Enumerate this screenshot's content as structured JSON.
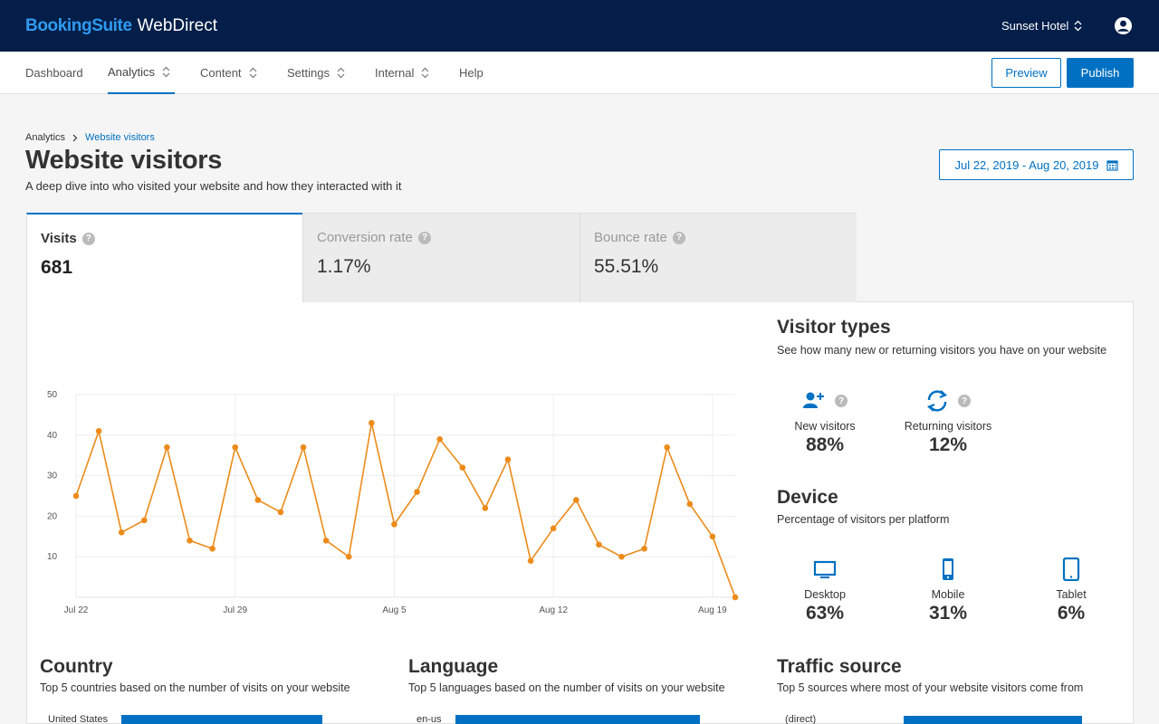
{
  "brand": {
    "part1": "BookingSuite",
    "part2": "WebDirect"
  },
  "hotel": {
    "name": "Sunset Hotel"
  },
  "nav": {
    "items": [
      {
        "label": "Dashboard"
      },
      {
        "label": "Analytics"
      },
      {
        "label": "Content"
      },
      {
        "label": "Settings"
      },
      {
        "label": "Internal"
      },
      {
        "label": "Help"
      }
    ],
    "active": "Analytics",
    "preview_label": "Preview",
    "publish_label": "Publish"
  },
  "breadcrumb": {
    "parent": "Analytics",
    "current": "Website visitors"
  },
  "page": {
    "title": "Website visitors",
    "subtitle": "A deep dive into who visited your website and how they interacted with it",
    "date_range": "Jul 22, 2019 - Aug 20, 2019"
  },
  "metrics": [
    {
      "label": "Visits",
      "value": "681"
    },
    {
      "label": "Conversion rate",
      "value": "1.17%"
    },
    {
      "label": "Bounce rate",
      "value": "55.51%"
    }
  ],
  "chart_data": {
    "type": "line",
    "x": [
      "Jul 22",
      "Jul 23",
      "Jul 24",
      "Jul 25",
      "Jul 26",
      "Jul 27",
      "Jul 28",
      "Jul 29",
      "Jul 30",
      "Jul 31",
      "Aug 1",
      "Aug 2",
      "Aug 3",
      "Aug 4",
      "Aug 5",
      "Aug 6",
      "Aug 7",
      "Aug 8",
      "Aug 9",
      "Aug 10",
      "Aug 11",
      "Aug 12",
      "Aug 13",
      "Aug 14",
      "Aug 15",
      "Aug 16",
      "Aug 17",
      "Aug 18",
      "Aug 19",
      "Aug 20"
    ],
    "values": [
      25,
      41,
      16,
      19,
      37,
      14,
      12,
      37,
      24,
      21,
      37,
      14,
      10,
      43,
      18,
      26,
      39,
      32,
      22,
      34,
      9,
      17,
      24,
      13,
      10,
      12,
      37,
      23,
      15,
      0
    ],
    "xticks": [
      "Jul 22",
      "Jul 29",
      "Aug 5",
      "Aug 12",
      "Aug 19"
    ],
    "yticks": [
      10,
      20,
      30,
      40,
      50
    ],
    "ylim": [
      0,
      50
    ],
    "color": "#ec8b1a",
    "grid": true
  },
  "visitor_types": {
    "title": "Visitor types",
    "subtitle": "See how many new or returning visitors you have on your website",
    "new_label": "New visitors",
    "new_value": "88%",
    "returning_label": "Returning visitors",
    "returning_value": "12%"
  },
  "device": {
    "title": "Device",
    "subtitle": "Percentage of visitors per platform",
    "items": [
      {
        "label": "Desktop",
        "value": "63%",
        "icon": "desktop-icon"
      },
      {
        "label": "Mobile",
        "value": "31%",
        "icon": "mobile-icon"
      },
      {
        "label": "Tablet",
        "value": "6%",
        "icon": "tablet-icon"
      }
    ]
  },
  "country": {
    "title": "Country",
    "subtitle": "Top 5 countries based on the number of visits on your website",
    "rows": [
      {
        "label": "United States"
      }
    ]
  },
  "language": {
    "title": "Language",
    "subtitle": "Top 5 languages based on the number of visits on your website",
    "rows": [
      {
        "label": "en-us"
      }
    ]
  },
  "traffic": {
    "title": "Traffic source",
    "subtitle": "Top 5 sources where most of your website visitors come from",
    "rows": [
      {
        "label": "(direct)"
      }
    ]
  },
  "colors": {
    "accent": "#0071c2",
    "topbar": "#021e49",
    "line": "#ec8b1a"
  }
}
